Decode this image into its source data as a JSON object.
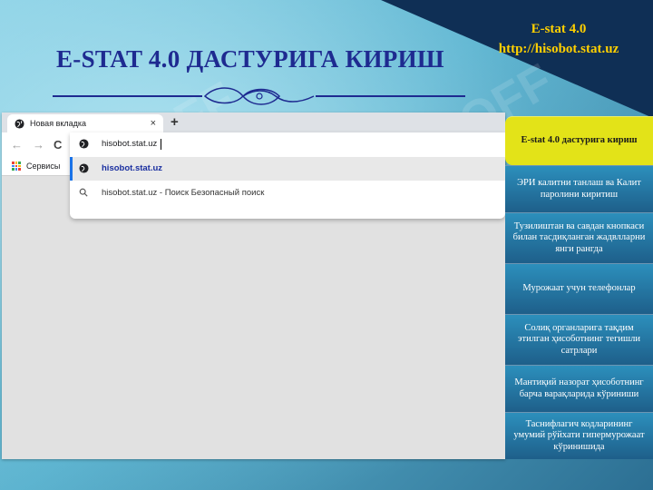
{
  "slide": {
    "title": "E-STAT 4.0 ДАСТУРИГА КИРИШ",
    "brand_line1": "E-stat 4.0",
    "brand_line2": "http://hisobot.stat.uz",
    "watermark": "SOFF"
  },
  "browser": {
    "tab_label": "Новая вкладка",
    "tab_close": "×",
    "new_tab": "+",
    "nav": {
      "back": "←",
      "forward": "→",
      "reload": "C"
    },
    "address_value": "hisobot.stat.uz",
    "bookmarks_label": "Сервисы",
    "suggestions": [
      "hisobot.stat.uz",
      "hisobot.stat.uz - Поиск Безопасный поиск"
    ]
  },
  "menu": {
    "items": [
      "E-stat 4.0 дастурига кириш",
      "ЭРИ калитни танлаш ва Калит паролини киритиш",
      "Тузилиштан ва савдан кнопкаси билан тасдиқланган жадвлларни янги рангда",
      "Мурожаат учун телефонлар",
      "Солиқ органларига тақдим этилган ҳисоботнинг тегишли сатрлари",
      "Мантиқий назорат ҳисоботнинг барча варақларида кўриниши",
      "Таснифлагич кодларининг умумий рўйхати гипермурожаат кўринишида"
    ]
  },
  "colors": {
    "title": "#1e2a90",
    "brand": "#ffd000",
    "menu_active": "#e3e318",
    "menu_bg": "#1e5f8a"
  }
}
